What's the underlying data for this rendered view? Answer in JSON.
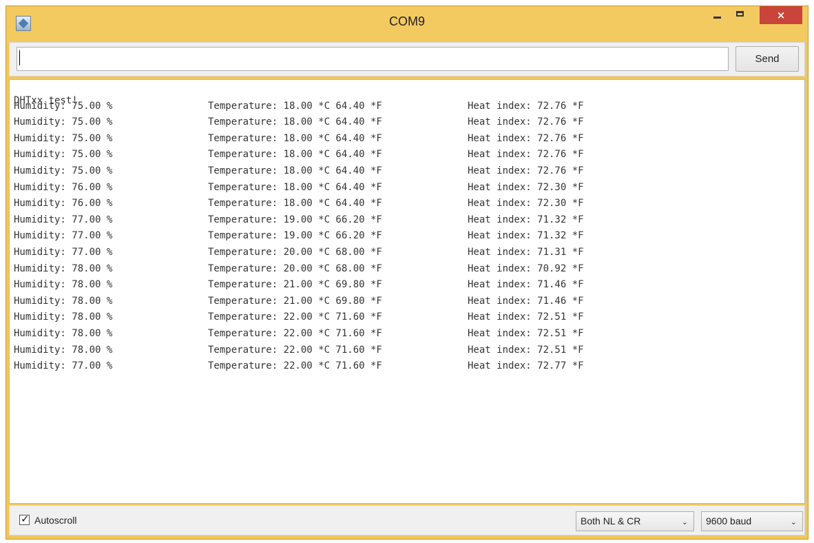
{
  "window": {
    "title": "COM9",
    "close_label": "×"
  },
  "send": {
    "input_value": "",
    "button_label": "Send"
  },
  "output": {
    "header": "DHTxx test!",
    "rows": [
      {
        "h": "Humidity: 75.00 %",
        "t": "Temperature: 18.00 *C 64.40 *F",
        "i": "Heat index: 72.76 *F"
      },
      {
        "h": "Humidity: 75.00 %",
        "t": "Temperature: 18.00 *C 64.40 *F",
        "i": "Heat index: 72.76 *F"
      },
      {
        "h": "Humidity: 75.00 %",
        "t": "Temperature: 18.00 *C 64.40 *F",
        "i": "Heat index: 72.76 *F"
      },
      {
        "h": "Humidity: 75.00 %",
        "t": "Temperature: 18.00 *C 64.40 *F",
        "i": "Heat index: 72.76 *F"
      },
      {
        "h": "Humidity: 75.00 %",
        "t": "Temperature: 18.00 *C 64.40 *F",
        "i": "Heat index: 72.76 *F"
      },
      {
        "h": "Humidity: 76.00 %",
        "t": "Temperature: 18.00 *C 64.40 *F",
        "i": "Heat index: 72.30 *F"
      },
      {
        "h": "Humidity: 76.00 %",
        "t": "Temperature: 18.00 *C 64.40 *F",
        "i": "Heat index: 72.30 *F"
      },
      {
        "h": "Humidity: 77.00 %",
        "t": "Temperature: 19.00 *C 66.20 *F",
        "i": "Heat index: 71.32 *F"
      },
      {
        "h": "Humidity: 77.00 %",
        "t": "Temperature: 19.00 *C 66.20 *F",
        "i": "Heat index: 71.32 *F"
      },
      {
        "h": "Humidity: 77.00 %",
        "t": "Temperature: 20.00 *C 68.00 *F",
        "i": "Heat index: 71.31 *F"
      },
      {
        "h": "Humidity: 78.00 %",
        "t": "Temperature: 20.00 *C 68.00 *F",
        "i": "Heat index: 70.92 *F"
      },
      {
        "h": "Humidity: 78.00 %",
        "t": "Temperature: 21.00 *C 69.80 *F",
        "i": "Heat index: 71.46 *F"
      },
      {
        "h": "Humidity: 78.00 %",
        "t": "Temperature: 21.00 *C 69.80 *F",
        "i": "Heat index: 71.46 *F"
      },
      {
        "h": "Humidity: 78.00 %",
        "t": "Temperature: 22.00 *C 71.60 *F",
        "i": "Heat index: 72.51 *F"
      },
      {
        "h": "Humidity: 78.00 %",
        "t": "Temperature: 22.00 *C 71.60 *F",
        "i": "Heat index: 72.51 *F"
      },
      {
        "h": "Humidity: 78.00 %",
        "t": "Temperature: 22.00 *C 71.60 *F",
        "i": "Heat index: 72.51 *F"
      },
      {
        "h": "Humidity: 77.00 %",
        "t": "Temperature: 22.00 *C 71.60 *F",
        "i": "Heat index: 72.77 *F"
      }
    ]
  },
  "footer": {
    "autoscroll_label": "Autoscroll",
    "autoscroll_checked": true,
    "line_ending": "Both NL & CR",
    "baud": "9600 baud"
  },
  "colors": {
    "title_bar": "#f3ca5f",
    "close_button": "#c9443a"
  },
  "icons": {
    "app": "java-cup-icon",
    "minimize": "minimize-icon",
    "maximize": "maximize-icon",
    "close": "close-icon",
    "dropdown": "chevron-down-icon"
  }
}
